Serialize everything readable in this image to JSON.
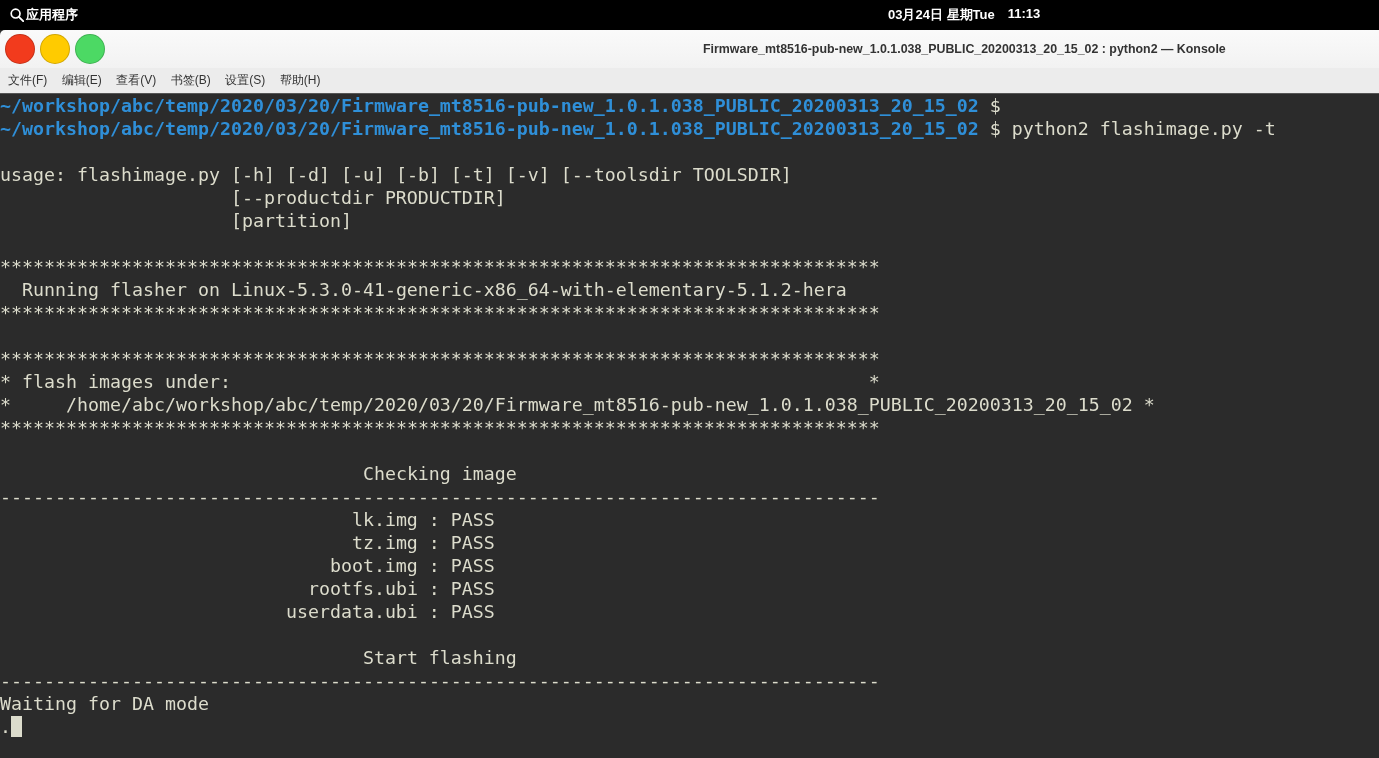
{
  "top_panel": {
    "applications_label": "应用程序",
    "date": "03月24日 星期Tue",
    "time": "11:13"
  },
  "window": {
    "title": "Firmware_mt8516-pub-new_1.0.1.038_PUBLIC_20200313_20_15_02 : python2 — Konsole",
    "controls": [
      {
        "color": "#f23b1d"
      },
      {
        "color": "#ffcb00"
      },
      {
        "color": "#4cd964"
      }
    ]
  },
  "menu": [
    "文件(F)",
    "编辑(E)",
    "查看(V)",
    "书签(B)",
    "设置(S)",
    "帮助(H)"
  ],
  "terminal": {
    "lines": [
      {
        "kind": "prompt",
        "path": "~/workshop/abc/temp/2020/03/20/Firmware_mt8516-pub-new_1.0.1.038_PUBLIC_20200313_20_15_02",
        "symbol": "$"
      },
      {
        "kind": "prompt",
        "path": "~/workshop/abc/temp/2020/03/20/Firmware_mt8516-pub-new_1.0.1.038_PUBLIC_20200313_20_15_02",
        "symbol": "$",
        "command": "python2 flashimage.py -t"
      },
      {
        "kind": "blank"
      },
      {
        "kind": "output",
        "text": "usage: flashimage.py [-h] [-d] [-u] [-b] [-t] [-v] [--toolsdir TOOLSDIR]"
      },
      {
        "kind": "output",
        "text": "                     [--productdir PRODUCTDIR]"
      },
      {
        "kind": "output",
        "text": "                     [partition]"
      },
      {
        "kind": "blank"
      },
      {
        "kind": "output",
        "text": "********************************************************************************"
      },
      {
        "kind": "output",
        "text": "  Running flasher on Linux-5.3.0-41-generic-x86_64-with-elementary-5.1.2-hera"
      },
      {
        "kind": "output",
        "text": "********************************************************************************"
      },
      {
        "kind": "blank"
      },
      {
        "kind": "output",
        "text": "********************************************************************************"
      },
      {
        "kind": "output",
        "text": "* flash images under:                                                          *"
      },
      {
        "kind": "output",
        "text": "*     /home/abc/workshop/abc/temp/2020/03/20/Firmware_mt8516-pub-new_1.0.1.038_PUBLIC_20200313_20_15_02 *"
      },
      {
        "kind": "output",
        "text": "********************************************************************************"
      },
      {
        "kind": "blank"
      },
      {
        "kind": "output",
        "text": "                                 Checking image"
      },
      {
        "kind": "output",
        "text": "--------------------------------------------------------------------------------"
      },
      {
        "kind": "output",
        "text": "                                lk.img : PASS"
      },
      {
        "kind": "output",
        "text": "                                tz.img : PASS"
      },
      {
        "kind": "output",
        "text": "                              boot.img : PASS"
      },
      {
        "kind": "output",
        "text": "                            rootfs.ubi : PASS"
      },
      {
        "kind": "output",
        "text": "                          userdata.ubi : PASS"
      },
      {
        "kind": "blank"
      },
      {
        "kind": "output",
        "text": "                                 Start flashing"
      },
      {
        "kind": "output",
        "text": "--------------------------------------------------------------------------------"
      },
      {
        "kind": "output",
        "text": "Waiting for DA mode"
      },
      {
        "kind": "cursor",
        "text": "."
      }
    ]
  }
}
